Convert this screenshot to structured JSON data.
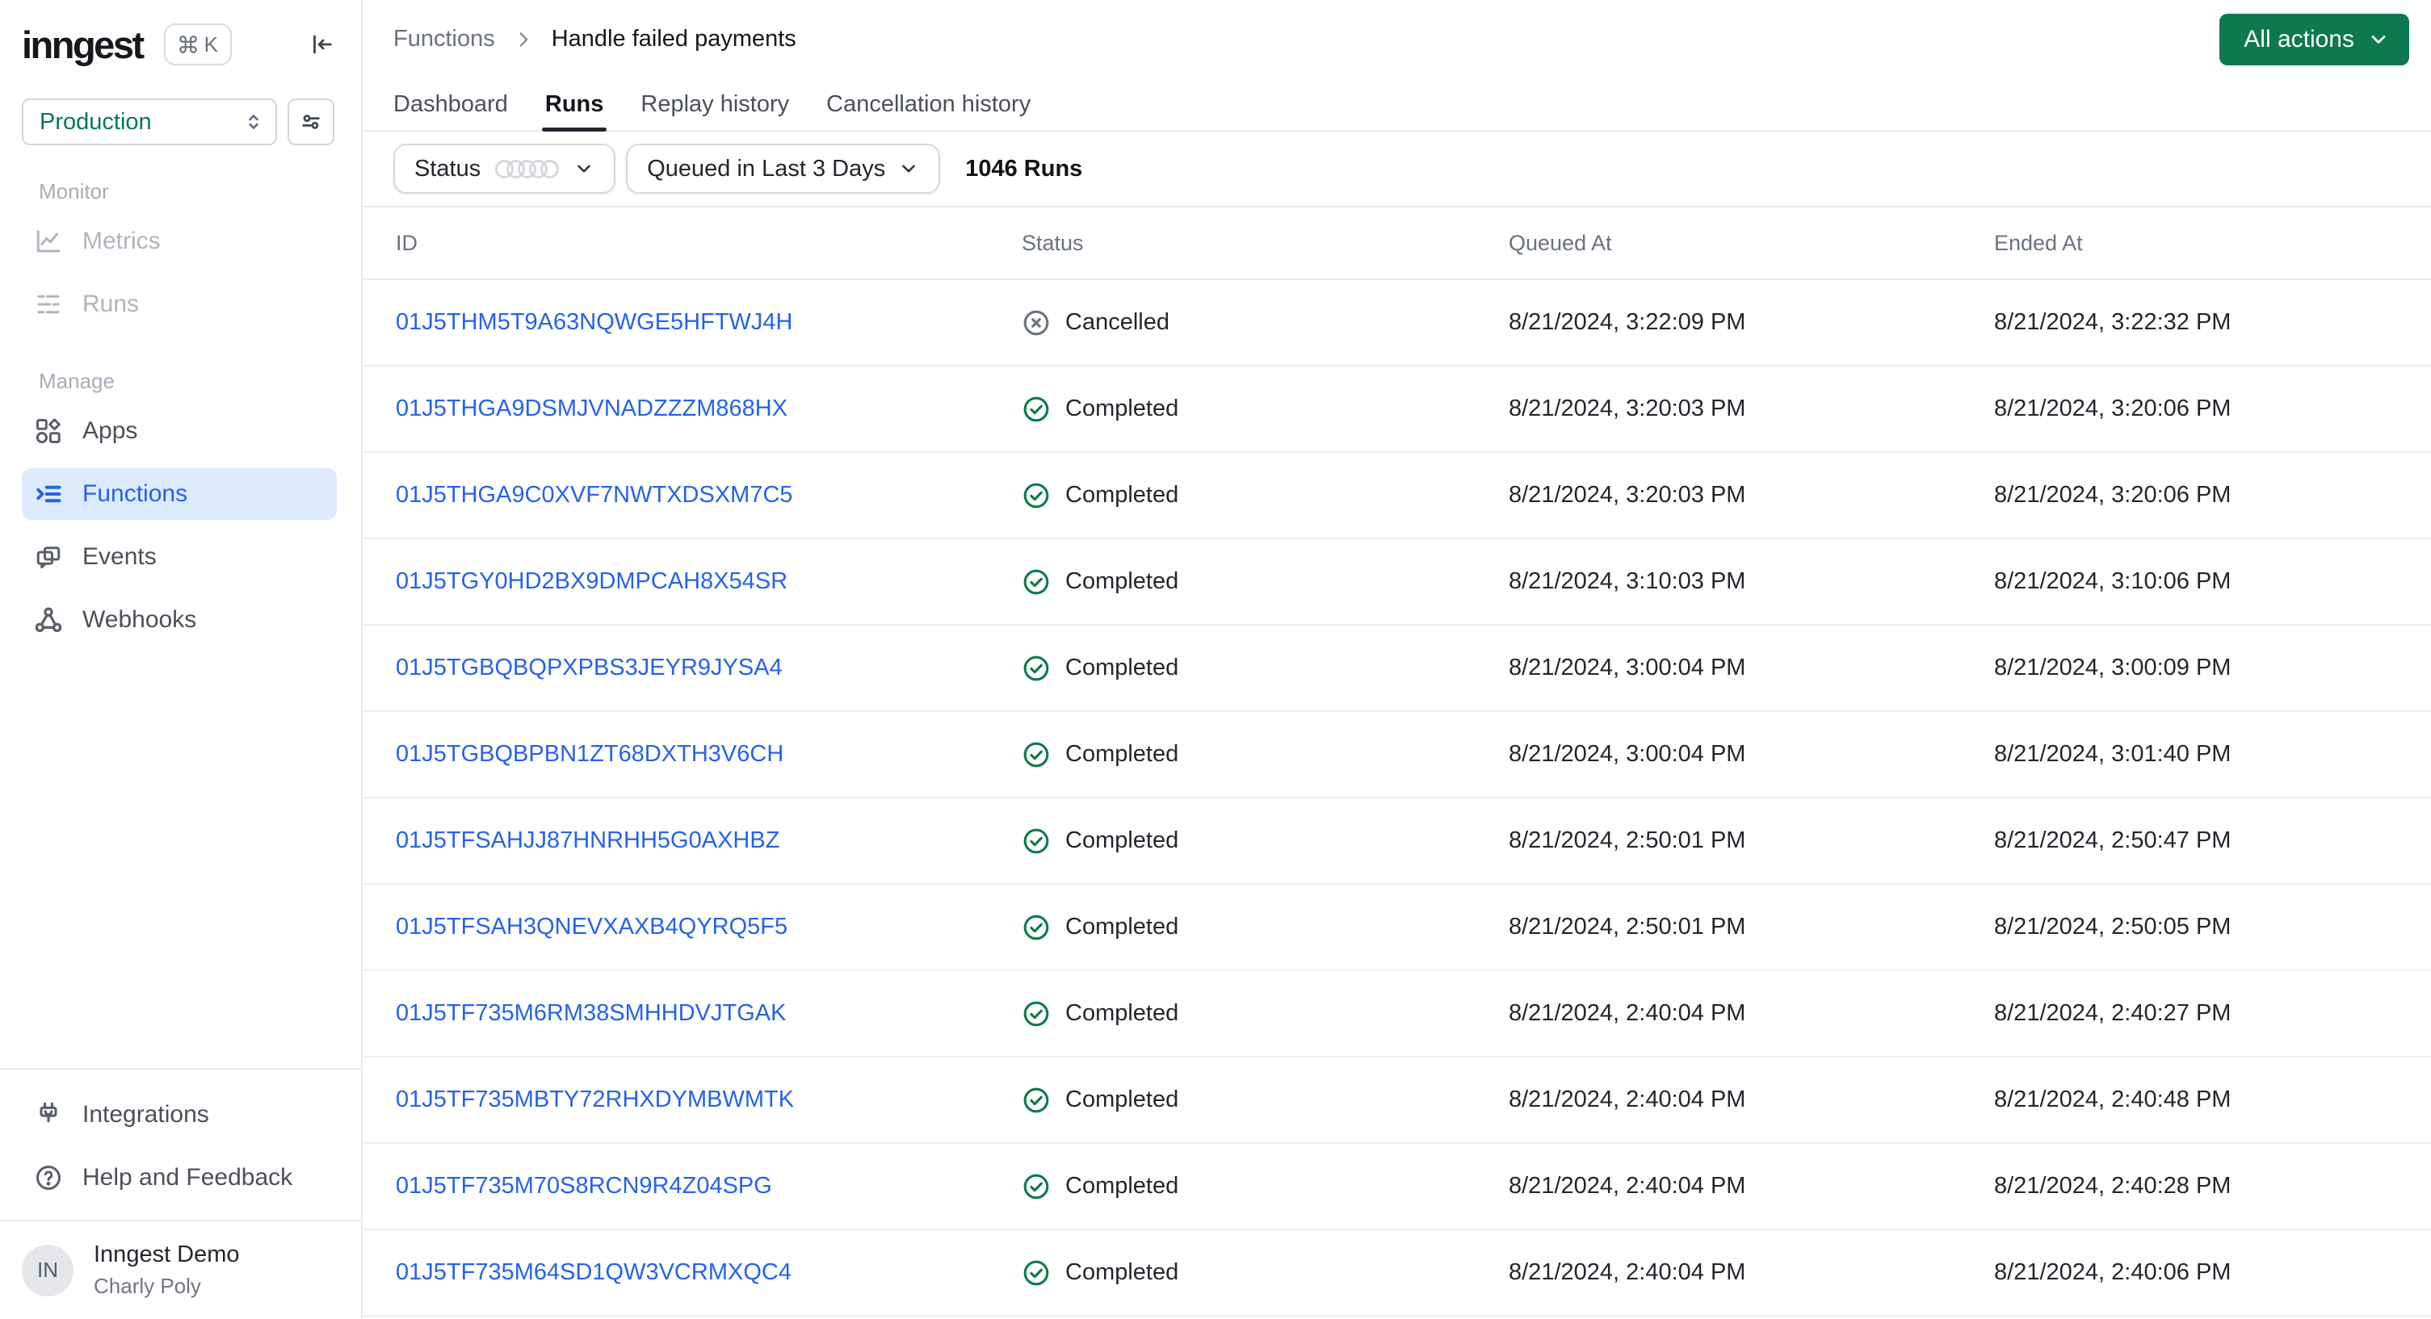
{
  "brand": {
    "logo": "inngest",
    "shortcut_key": "K"
  },
  "workspace": {
    "environment": "Production"
  },
  "sidebar": {
    "sections": [
      {
        "label": "Monitor",
        "items": [
          {
            "label": "Metrics",
            "icon": "metrics-icon",
            "muted": true
          },
          {
            "label": "Runs",
            "icon": "runs-icon",
            "muted": true
          }
        ]
      },
      {
        "label": "Manage",
        "items": [
          {
            "label": "Apps",
            "icon": "apps-icon"
          },
          {
            "label": "Functions",
            "icon": "functions-icon",
            "active": true
          },
          {
            "label": "Events",
            "icon": "events-icon"
          },
          {
            "label": "Webhooks",
            "icon": "webhooks-icon"
          }
        ]
      }
    ],
    "footer_items": [
      {
        "label": "Integrations",
        "icon": "integrations-icon"
      },
      {
        "label": "Help and Feedback",
        "icon": "help-icon"
      }
    ],
    "profile": {
      "initials": "IN",
      "name": "Inngest Demo",
      "subtitle": "Charly Poly"
    }
  },
  "header": {
    "breadcrumb": {
      "root": "Functions",
      "current": "Handle failed payments"
    },
    "actions_button": "All actions"
  },
  "tabs": [
    {
      "label": "Dashboard"
    },
    {
      "label": "Runs",
      "active": true
    },
    {
      "label": "Replay history"
    },
    {
      "label": "Cancellation history"
    }
  ],
  "filters": {
    "status_label": "Status",
    "time_filter": "Queued in Last 3 Days",
    "runs_count": "1046 Runs"
  },
  "table": {
    "columns": [
      "ID",
      "Status",
      "Queued At",
      "Ended At"
    ],
    "rows": [
      {
        "id": "01J5THM5T9A63NQWGE5HFTWJ4H",
        "status": "Cancelled",
        "queued_at": "8/21/2024, 3:22:09 PM",
        "ended_at": "8/21/2024, 3:22:32 PM"
      },
      {
        "id": "01J5THGA9DSMJVNADZZZM868HX",
        "status": "Completed",
        "queued_at": "8/21/2024, 3:20:03 PM",
        "ended_at": "8/21/2024, 3:20:06 PM"
      },
      {
        "id": "01J5THGA9C0XVF7NWTXDSXM7C5",
        "status": "Completed",
        "queued_at": "8/21/2024, 3:20:03 PM",
        "ended_at": "8/21/2024, 3:20:06 PM"
      },
      {
        "id": "01J5TGY0HD2BX9DMPCAH8X54SR",
        "status": "Completed",
        "queued_at": "8/21/2024, 3:10:03 PM",
        "ended_at": "8/21/2024, 3:10:06 PM"
      },
      {
        "id": "01J5TGBQBQPXPBS3JEYR9JYSA4",
        "status": "Completed",
        "queued_at": "8/21/2024, 3:00:04 PM",
        "ended_at": "8/21/2024, 3:00:09 PM"
      },
      {
        "id": "01J5TGBQBPBN1ZT68DXTH3V6CH",
        "status": "Completed",
        "queued_at": "8/21/2024, 3:00:04 PM",
        "ended_at": "8/21/2024, 3:01:40 PM"
      },
      {
        "id": "01J5TFSAHJJ87HNRHH5G0AXHBZ",
        "status": "Completed",
        "queued_at": "8/21/2024, 2:50:01 PM",
        "ended_at": "8/21/2024, 2:50:47 PM"
      },
      {
        "id": "01J5TFSAH3QNEVXAXB4QYRQ5F5",
        "status": "Completed",
        "queued_at": "8/21/2024, 2:50:01 PM",
        "ended_at": "8/21/2024, 2:50:05 PM"
      },
      {
        "id": "01J5TF735M6RM38SMHHDVJTGAK",
        "status": "Completed",
        "queued_at": "8/21/2024, 2:40:04 PM",
        "ended_at": "8/21/2024, 2:40:27 PM"
      },
      {
        "id": "01J5TF735MBTY72RHXDYMBWMTK",
        "status": "Completed",
        "queued_at": "8/21/2024, 2:40:04 PM",
        "ended_at": "8/21/2024, 2:40:48 PM"
      },
      {
        "id": "01J5TF735M70S8RCN9R4Z04SPG",
        "status": "Completed",
        "queued_at": "8/21/2024, 2:40:04 PM",
        "ended_at": "8/21/2024, 2:40:28 PM"
      },
      {
        "id": "01J5TF735M64SD1QW3VCRMXQC4",
        "status": "Completed",
        "queued_at": "8/21/2024, 2:40:04 PM",
        "ended_at": "8/21/2024, 2:40:06 PM"
      }
    ]
  },
  "colors": {
    "accent_green": "#0e7850",
    "link_blue": "#2563eb",
    "active_nav_bg": "#dcebfc",
    "status_completed": "#0d7c4b",
    "status_cancelled": "#6b7280"
  }
}
